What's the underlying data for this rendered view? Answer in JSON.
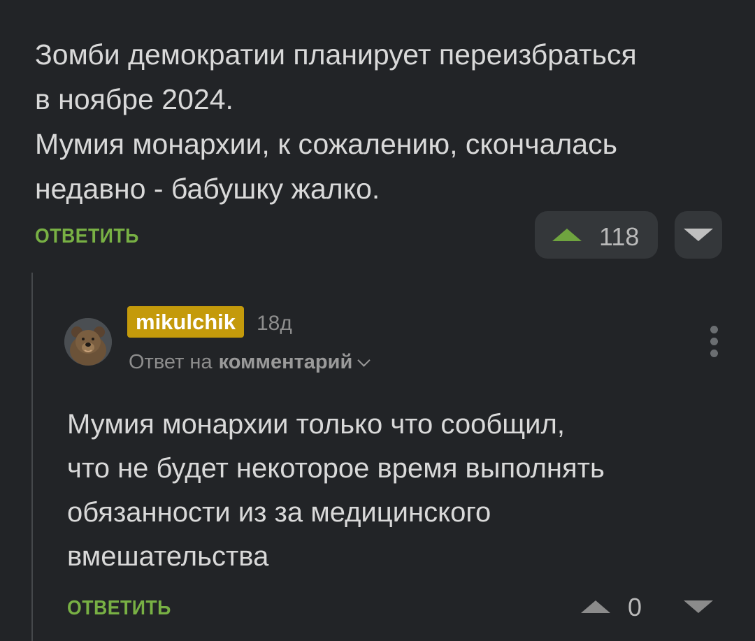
{
  "parent_comment": {
    "lines": [
      "Зомби демократии планирует переизбраться",
      "в ноябре 2024.",
      "Мумия монархии, к сожалению, скончалась",
      "недавно - бабушку жалко."
    ],
    "reply_label": "ОТВЕТИТЬ",
    "rating": "118"
  },
  "reply_comment": {
    "username": "mikulchik",
    "time": "18д",
    "reply_prefix": "Ответ на",
    "reply_target": "комментарий",
    "lines": [
      "Мумия монархии только что сообщил,",
      "что не будет некоторое время выполнять",
      "обязанности из за медицинского",
      "вмешательства"
    ],
    "reply_label": "ОТВЕТИТЬ",
    "rating": "0"
  },
  "icons": {
    "upvote": "triangle-up-icon",
    "downvote": "triangle-down-icon",
    "more": "vertical-dots-icon",
    "expand": "chevron-down-icon"
  },
  "colors": {
    "background": "#222427",
    "accent_green": "#78b044",
    "username_badge": "#c49a0b"
  }
}
